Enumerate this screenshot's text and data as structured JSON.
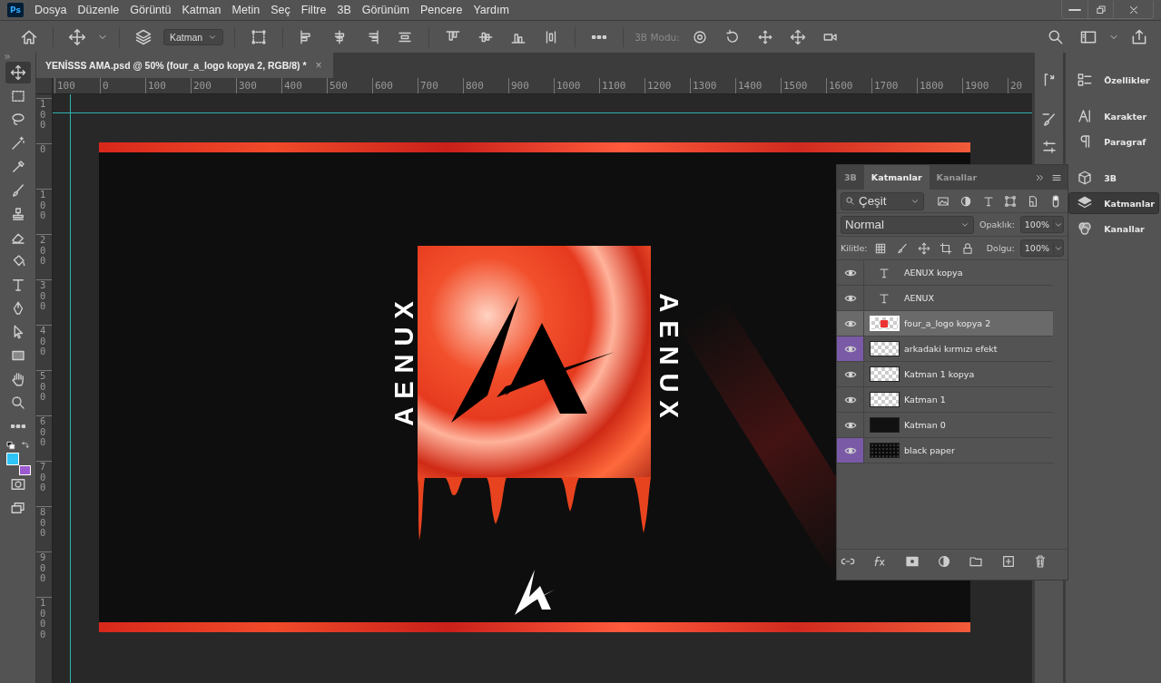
{
  "app": {
    "logo": "Ps"
  },
  "menu": [
    "Dosya",
    "Düzenle",
    "Görüntü",
    "Katman",
    "Metin",
    "Seç",
    "Filtre",
    "3B",
    "Görünüm",
    "Pencere",
    "Yardım"
  ],
  "options_bar": {
    "auto_select": "Katman",
    "mode_label": "3B Modu:"
  },
  "tools": [
    {
      "kind": "move",
      "selected": true
    },
    {
      "kind": "marquee",
      "selected": false
    },
    {
      "kind": "lasso",
      "selected": false
    },
    {
      "kind": "wand",
      "selected": false
    },
    {
      "kind": "eyedropper",
      "selected": false
    },
    {
      "kind": "brush",
      "selected": false
    },
    {
      "kind": "stamp",
      "selected": false
    },
    {
      "kind": "eraser",
      "selected": false
    },
    {
      "kind": "bucket",
      "selected": false
    },
    {
      "kind": "type",
      "selected": false
    },
    {
      "kind": "pen",
      "selected": false
    },
    {
      "kind": "arrow",
      "selected": false
    },
    {
      "kind": "rectangle",
      "selected": false
    },
    {
      "kind": "hand",
      "selected": false
    },
    {
      "kind": "zoom",
      "selected": false
    },
    {
      "kind": "more",
      "selected": false
    }
  ],
  "document_tab": {
    "title": "YENİSSS AMA.psd @ 50% (four_a_logo kopya 2, RGB/8) *",
    "close": "×"
  },
  "rulers": {
    "horizontal": [
      "100",
      "0",
      "100",
      "200",
      "300",
      "400",
      "500",
      "600",
      "700",
      "800",
      "900",
      "1000",
      "1100",
      "1200",
      "1300",
      "1400",
      "1500",
      "1600",
      "1700",
      "1800",
      "1900",
      "20"
    ],
    "vertical": [
      "100",
      "0",
      "100",
      "200",
      "300",
      "400",
      "500",
      "600",
      "700",
      "800",
      "900",
      "1000"
    ]
  },
  "canvas": {
    "texts": [
      "AENUX",
      "AENUX"
    ]
  },
  "layers_panel": {
    "tabs": [
      {
        "label": "3B",
        "selected": false
      },
      {
        "label": "Katmanlar",
        "selected": true
      },
      {
        "label": "Kanallar",
        "selected": false
      }
    ],
    "filter": "Çeşit",
    "blend_mode": "Normal",
    "opacity_label": "Opaklık:",
    "opacity": "100%",
    "lock_label": "Kilitle:",
    "fill_label": "Dolgu:",
    "fill": "100%",
    "layers": [
      {
        "name": "AENUX kopya",
        "kind": "text",
        "visible": true,
        "selected": false
      },
      {
        "name": "AENUX",
        "kind": "text",
        "visible": true,
        "selected": false
      },
      {
        "name": "four_a_logo kopya 2",
        "kind": "logo",
        "visible": true,
        "selected": true
      },
      {
        "name": "arkadaki kırmızı efekt",
        "kind": "effect",
        "visible": true,
        "selected": false,
        "color": "#7a5aa6"
      },
      {
        "name": "Katman 1 kopya",
        "kind": "transparent",
        "visible": true,
        "selected": false
      },
      {
        "name": "Katman 1",
        "kind": "transparent",
        "visible": true,
        "selected": false
      },
      {
        "name": "Katman 0",
        "kind": "solid",
        "visible": true,
        "selected": false
      },
      {
        "name": "black paper",
        "kind": "texture",
        "visible": true,
        "selected": false,
        "color": "#7a5aa6"
      }
    ]
  },
  "side_panels": [
    {
      "label": "Özellikler",
      "kind": "properties",
      "selected": false
    },
    {
      "label": "Karakter",
      "kind": "character",
      "selected": false
    },
    {
      "label": "Paragraf",
      "kind": "paragraph",
      "selected": false
    },
    {
      "label": "3B",
      "kind": "cube",
      "selected": false
    },
    {
      "label": "Katmanlar",
      "kind": "layers",
      "selected": true
    },
    {
      "label": "Kanallar",
      "kind": "channels",
      "selected": false
    }
  ]
}
